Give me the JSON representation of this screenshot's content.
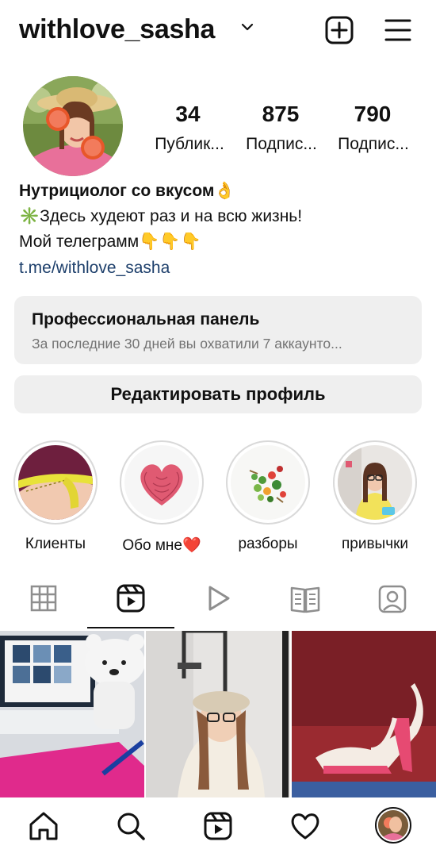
{
  "header": {
    "username": "withlove_sasha",
    "icons": [
      "chevron-down-icon",
      "new-post-icon",
      "menu-icon"
    ]
  },
  "stats": [
    {
      "value": "34",
      "label": "Публик..."
    },
    {
      "value": "875",
      "label": "Подпис..."
    },
    {
      "value": "790",
      "label": "Подпис..."
    }
  ],
  "bio": {
    "name": "Нутрициолог со вкусом👌",
    "line1": "✳️Здесь худеют раз и на всю жизнь!",
    "line2": "Мой телеграмм👇👇👇",
    "link": "t.me/withlove_sasha"
  },
  "pro_panel": {
    "title": "Профессиональная панель",
    "subtitle": "За последние 30 дней вы охватили 7 аккаунто..."
  },
  "edit_button": "Редактировать профиль",
  "highlights": [
    {
      "label": "Клиенты"
    },
    {
      "label": "Обо мне❤️"
    },
    {
      "label": "разборы"
    },
    {
      "label": "привычки"
    }
  ],
  "tabs": [
    "grid-icon",
    "reels-icon",
    "play-icon",
    "guide-icon",
    "tagged-icon"
  ],
  "bottom_nav": [
    "home-icon",
    "search-icon",
    "reels-icon",
    "heart-icon",
    "profile-avatar"
  ]
}
